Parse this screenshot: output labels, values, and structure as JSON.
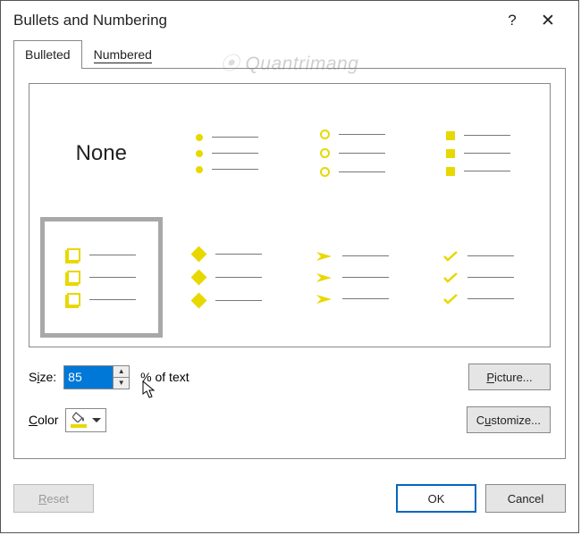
{
  "title": "Bullets and Numbering",
  "tabs": {
    "bulleted": "Bulleted",
    "numbered": "Numbered"
  },
  "gallery": {
    "none": "None"
  },
  "size": {
    "label_pre": "S",
    "label_ul": "i",
    "label_post": "ze:",
    "value": "85",
    "pct": "% of text"
  },
  "color": {
    "label_pre": "",
    "label_ul": "C",
    "label_post": "olor"
  },
  "buttons": {
    "picture_pre": "",
    "picture_ul": "P",
    "picture_post": "icture...",
    "customize_pre": "C",
    "customize_ul": "u",
    "customize_post": "stomize...",
    "reset_pre": "",
    "reset_ul": "R",
    "reset_post": "eset",
    "ok": "OK",
    "cancel": "Cancel"
  },
  "watermark": "Quantrimang"
}
